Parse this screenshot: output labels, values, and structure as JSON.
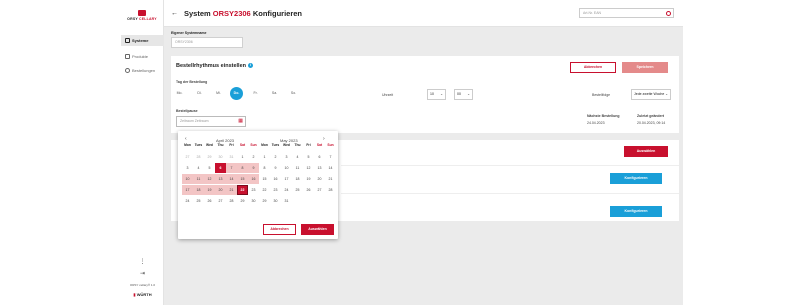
{
  "sidebar": {
    "logo_prefix": "ORSY",
    "logo_suffix": "CELLARY",
    "items": [
      {
        "label": "Systeme",
        "active": true
      },
      {
        "label": "Produkte",
        "active": false
      },
      {
        "label": "Bestellungen",
        "active": false
      }
    ],
    "more_icon": "more-vertical-icon",
    "logout_icon": "logout-icon",
    "version": "ORSY cellary® 1.0",
    "footer_brand": "WÜRTH"
  },
  "header": {
    "back_icon": "arrow-left-icon",
    "title_prefix": "System",
    "title_highlight": "ORSY2306",
    "title_suffix": "Konfigurieren",
    "search_placeholder": "Art.Nr. EAN"
  },
  "form": {
    "system_name_label": "Eigener Systemname",
    "system_name_value": "ORSY2306"
  },
  "rhythm": {
    "title": "Bestellrhythmus einstellen",
    "info_icon": "i",
    "cancel_label": "Abbrechen",
    "save_label": "Speichern",
    "day_label": "Tag der Bestellung",
    "days": [
      "Mo.",
      "Di.",
      "Mi.",
      "Do.",
      "Fr.",
      "Sa.",
      "So."
    ],
    "selected_day": "Do.",
    "time_label": "Uhrzeit",
    "hour": "10",
    "minute": "00",
    "frequency_label": "Bestellfolge",
    "frequency_value": "Jede zweite Woche",
    "period_label": "Bestellpause",
    "period_placeholder": "Zeitraum Zeitraum",
    "next_order_label": "Nächste Bestellung",
    "next_order_value": "24.04.2023",
    "last_changed_label": "Zuletzt geändert",
    "last_changed_value": "20.04.2023, 09:14"
  },
  "products": {
    "add_label": "Auswählen",
    "configure_label": "Konfigurieren"
  },
  "calendar": {
    "prev_icon": "chevron-left-icon",
    "next_icon": "chevron-right-icon",
    "weekdays": [
      "Mon",
      "Tues",
      "Wed",
      "Thu",
      "Fri",
      "Sat",
      "Sun"
    ],
    "month1": "April 2023",
    "month2": "May 2023",
    "month1_days": [
      "27",
      "28",
      "29",
      "30",
      "31",
      "1",
      "2",
      "3",
      "4",
      "5",
      "6",
      "7",
      "8",
      "9",
      "10",
      "11",
      "12",
      "13",
      "14",
      "15",
      "16",
      "17",
      "18",
      "19",
      "20",
      "21",
      "22",
      "23",
      "24",
      "25",
      "26",
      "27",
      "28",
      "29",
      "30"
    ],
    "month2_days": [
      "1",
      "2",
      "3",
      "4",
      "5",
      "6",
      "7",
      "8",
      "9",
      "10",
      "11",
      "12",
      "13",
      "14",
      "15",
      "16",
      "17",
      "18",
      "19",
      "20",
      "21",
      "22",
      "23",
      "24",
      "25",
      "26",
      "27",
      "28",
      "29",
      "30",
      "31"
    ],
    "cancel_label": "Abbrechen",
    "confirm_label": "Auswählen"
  },
  "colors": {
    "accent": "#c8102e",
    "info": "#1a9fd8"
  }
}
